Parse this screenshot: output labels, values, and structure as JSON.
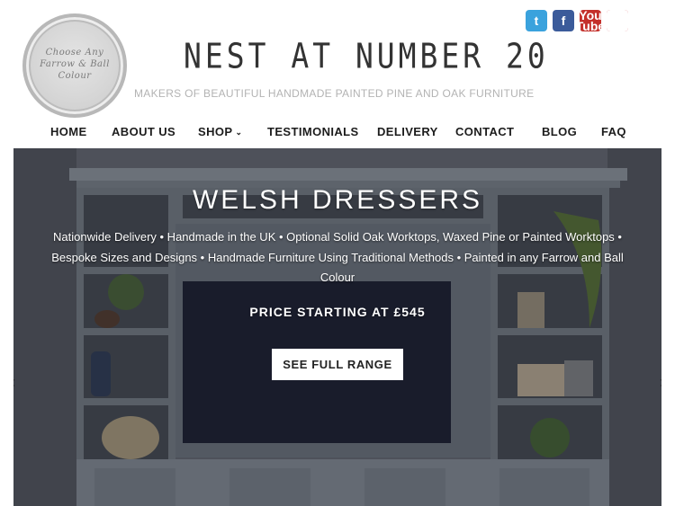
{
  "logo": {
    "line1": "Choose Any",
    "line2": "Farrow & Ball",
    "line3": "Colour"
  },
  "site": {
    "title": "NEST AT NUMBER 20",
    "tagline": "MAKERS OF BEAUTIFUL HANDMADE PAINTED PINE AND OAK FURNITURE"
  },
  "social": {
    "twitter": "t",
    "facebook": "f",
    "youtube_top": "You",
    "youtube_bottom": "Tube",
    "pinterest": "P"
  },
  "nav": {
    "home": "HOME",
    "about": "ABOUT US",
    "shop": "SHOP",
    "testimonials": "TESTIMONIALS",
    "delivery": "DELIVERY",
    "contact": "CONTACT",
    "blog": "BLOG",
    "faq": "FAQ"
  },
  "hero": {
    "title": "WELSH DRESSERS",
    "description": "Nationwide Delivery • Handmade in the UK • Optional Solid Oak Worktops, Waxed Pine or Painted Worktops • Bespoke Sizes and Designs • Handmade Furniture Using Traditional Methods • Painted in any Farrow and Ball Colour",
    "price": "PRICE STARTING AT £545",
    "button": "SEE FULL RANGE",
    "prev": "‹",
    "next": "›"
  },
  "colors": {
    "twitter": "#3aa2dd",
    "facebook": "#3b5b9a",
    "youtube": "#c4302b",
    "pinterest": "#cb2027",
    "cabinet": "#8f97a2",
    "tv": "#1c1f33"
  }
}
